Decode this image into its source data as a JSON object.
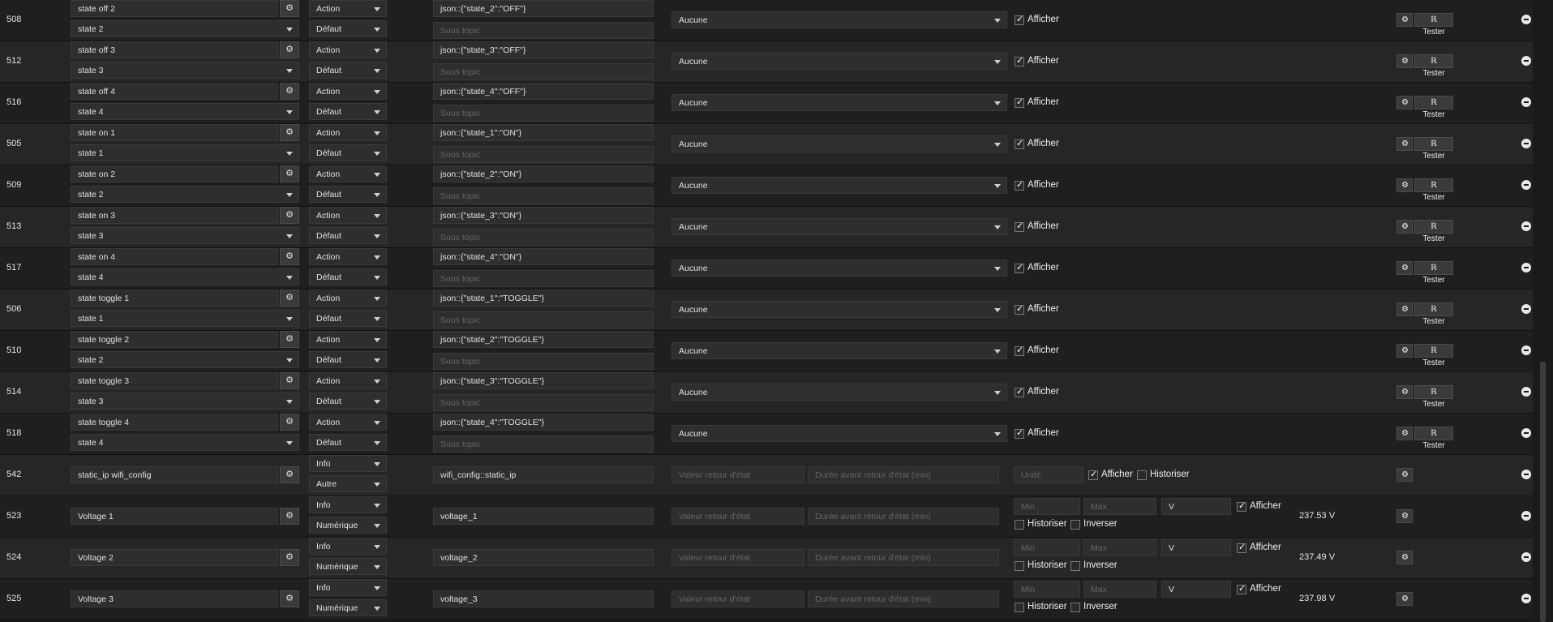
{
  "labels": {
    "type_action": "Action",
    "type_info": "Info",
    "subtype_default": "Défaut",
    "subtype_other": "Autre",
    "subtype_numeric": "Numérique",
    "subtopic_placeholder": "Sous topic",
    "aucune": "Aucune",
    "afficher": "Afficher",
    "historiser": "Historiser",
    "inverser": "Inverser",
    "tester": "Tester",
    "valeur_retour": "Valeur retour d'état",
    "duree_retour": "Durée avant retour d'état (min)",
    "unite": "Unité",
    "min": "Min",
    "max": "Max"
  },
  "icons": {
    "config": "config-icon",
    "gears": "gears-icon",
    "rss": "rss-icon",
    "remove": "minus-circle-icon"
  },
  "rows": [
    {
      "id": "508",
      "name": "state off 2",
      "value": "state 2",
      "type": "Action",
      "subtype": "Défaut",
      "topic": "json::{\"state_2\":\"OFF\"}"
    },
    {
      "id": "512",
      "name": "state off 3",
      "value": "state 3",
      "type": "Action",
      "subtype": "Défaut",
      "topic": "json::{\"state_3\":\"OFF\"}"
    },
    {
      "id": "516",
      "name": "state off 4",
      "value": "state 4",
      "type": "Action",
      "subtype": "Défaut",
      "topic": "json::{\"state_4\":\"OFF\"}"
    },
    {
      "id": "505",
      "name": "state on 1",
      "value": "state 1",
      "type": "Action",
      "subtype": "Défaut",
      "topic": "json::{\"state_1\":\"ON\"}"
    },
    {
      "id": "509",
      "name": "state on 2",
      "value": "state 2",
      "type": "Action",
      "subtype": "Défaut",
      "topic": "json::{\"state_2\":\"ON\"}"
    },
    {
      "id": "513",
      "name": "state on 3",
      "value": "state 3",
      "type": "Action",
      "subtype": "Défaut",
      "topic": "json::{\"state_3\":\"ON\"}"
    },
    {
      "id": "517",
      "name": "state on 4",
      "value": "state 4",
      "type": "Action",
      "subtype": "Défaut",
      "topic": "json::{\"state_4\":\"ON\"}"
    },
    {
      "id": "506",
      "name": "state toggle 1",
      "value": "state 1",
      "type": "Action",
      "subtype": "Défaut",
      "topic": "json::{\"state_1\":\"TOGGLE\"}"
    },
    {
      "id": "510",
      "name": "state toggle 2",
      "value": "state 2",
      "type": "Action",
      "subtype": "Défaut",
      "topic": "json::{\"state_2\":\"TOGGLE\"}"
    },
    {
      "id": "514",
      "name": "state toggle 3",
      "value": "state 3",
      "type": "Action",
      "subtype": "Défaut",
      "topic": "json::{\"state_3\":\"TOGGLE\"}"
    },
    {
      "id": "518",
      "name": "state toggle 4",
      "value": "state 4",
      "type": "Action",
      "subtype": "Défaut",
      "topic": "json::{\"state_4\":\"TOGGLE\"}"
    }
  ],
  "info_rows": [
    {
      "id": "542",
      "name": "static_ip wifi_config",
      "type": "Info",
      "subtype": "Autre",
      "topic": "wifi_config::static_ip",
      "kind": "other"
    },
    {
      "id": "523",
      "name": "Voltage 1",
      "type": "Info",
      "subtype": "Numérique",
      "topic": "voltage_1",
      "kind": "numeric",
      "unit": "V",
      "current": "237.53 V"
    },
    {
      "id": "524",
      "name": "Voltage 2",
      "type": "Info",
      "subtype": "Numérique",
      "topic": "voltage_2",
      "kind": "numeric",
      "unit": "V",
      "current": "237.49 V"
    },
    {
      "id": "525",
      "name": "Voltage 3",
      "type": "Info",
      "subtype": "Numérique",
      "topic": "voltage_3",
      "kind": "numeric",
      "unit": "V",
      "current": "237.98 V"
    }
  ]
}
